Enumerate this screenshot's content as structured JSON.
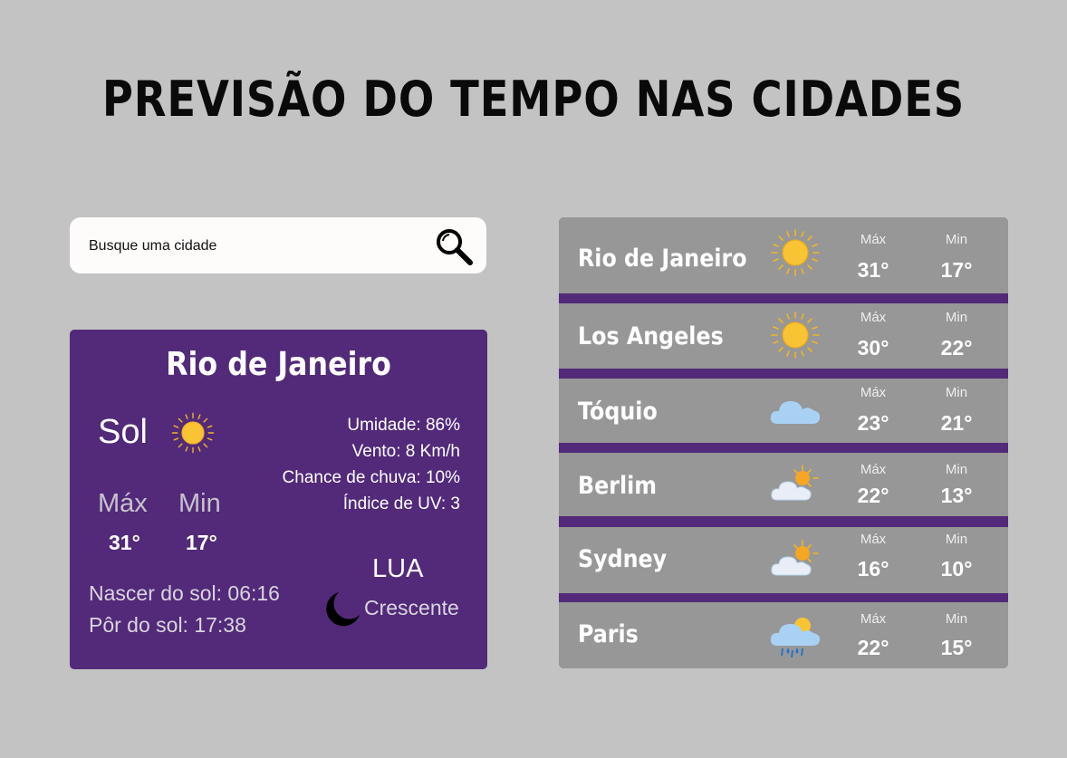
{
  "page": {
    "title": "PREVISÃO DO TEMPO NAS CIDADES"
  },
  "search": {
    "placeholder": "Busque uma cidade",
    "icon": "search-icon"
  },
  "current": {
    "city": "Rio de Janeiro",
    "condition": "Sol",
    "condition_icon": "sun-icon",
    "max_label": "Máx",
    "min_label": "Min",
    "max": "31°",
    "min": "17°",
    "humidity": "Umidade: 86%",
    "wind": "Vento: 8 Km/h",
    "rain_chance": "Chance de chuva: 10%",
    "uv_index": "Índice de UV: 3",
    "sunrise": "Nascer do sol: 06:16",
    "sunset": "Pôr do sol: 17:38",
    "moon_title": "LUA",
    "moon_phase": "Crescente",
    "moon_icon": "crescent-moon-icon"
  },
  "forecast": [
    {
      "city": "Rio de Janeiro",
      "icon": "sun-icon",
      "max_label": "Máx",
      "min_label": "Min",
      "max": "31°",
      "min": "17°"
    },
    {
      "city": "Los Angeles",
      "icon": "sun-icon",
      "max_label": "Máx",
      "min_label": "Min",
      "max": "30°",
      "min": "22°"
    },
    {
      "city": "Tóquio",
      "icon": "cloud-icon",
      "max_label": "Máx",
      "min_label": "Min",
      "max": "23°",
      "min": "21°"
    },
    {
      "city": "Berlim",
      "icon": "partly-cloudy-icon",
      "max_label": "Máx",
      "min_label": "Min",
      "max": "22°",
      "min": "13°"
    },
    {
      "city": "Sydney",
      "icon": "partly-cloudy-icon",
      "max_label": "Máx",
      "min_label": "Min",
      "max": "16°",
      "min": "10°"
    },
    {
      "city": "Paris",
      "icon": "rain-icon",
      "max_label": "Máx",
      "min_label": "Min",
      "max": "22°",
      "min": "15°"
    }
  ],
  "colors": {
    "background": "#c3c3c3",
    "card": "#522a79",
    "row": "#979797",
    "sun": "#f8c434",
    "sun_rays": "#f2b623",
    "cloud": "#a9d1f4"
  }
}
